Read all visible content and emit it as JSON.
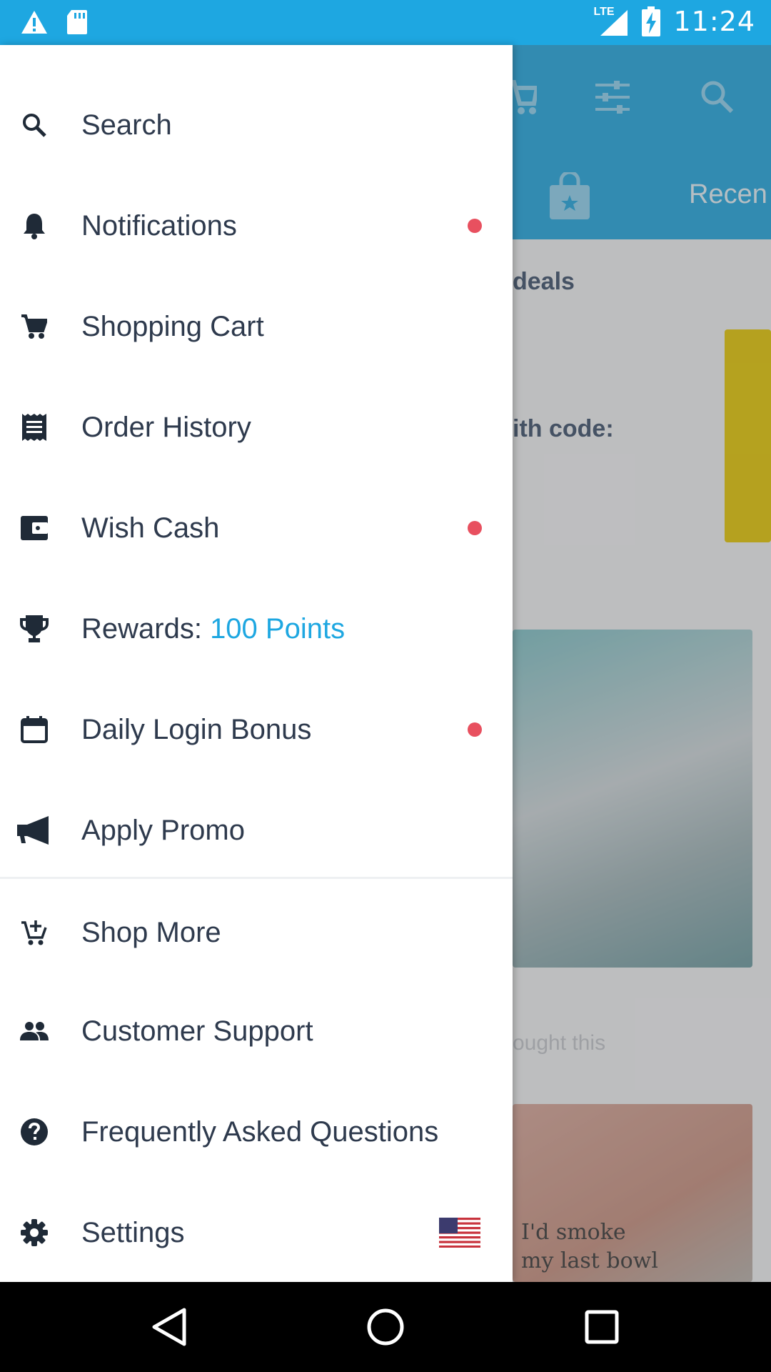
{
  "status_bar": {
    "time": "11:24",
    "network": "LTE",
    "icons": [
      "warning-icon",
      "sd-card-icon",
      "signal-icon",
      "battery-charging-icon"
    ]
  },
  "background": {
    "recent_tab": "Recen",
    "deals_text": "deals",
    "code_text": "ith code:",
    "bought_text": "ought this",
    "product_caption": "I'd smoke my last bowl"
  },
  "drawer": {
    "items": [
      {
        "label": "Search",
        "icon": "search-icon"
      },
      {
        "label": "Notifications",
        "icon": "bell-icon",
        "has_dot": true
      },
      {
        "label": "Shopping Cart",
        "icon": "cart-icon"
      },
      {
        "label": "Order History",
        "icon": "receipt-icon"
      },
      {
        "label": "Wish Cash",
        "icon": "wallet-icon",
        "has_dot": true
      },
      {
        "label": "Rewards: ",
        "accent": "100 Points",
        "icon": "trophy-icon"
      },
      {
        "label": "Daily Login Bonus",
        "icon": "calendar-icon",
        "has_dot": true
      },
      {
        "label": "Apply Promo",
        "icon": "megaphone-icon"
      },
      {
        "label": "Shop More",
        "icon": "add-cart-icon"
      },
      {
        "label": "Customer Support",
        "icon": "people-icon"
      },
      {
        "label": "Frequently Asked Questions",
        "icon": "help-icon"
      },
      {
        "label": "Settings",
        "icon": "gear-icon",
        "flag": "us-flag-icon"
      }
    ]
  },
  "colors": {
    "brand": "#1ea7e1",
    "dot": "#e8505f",
    "text": "#2e3a4d"
  },
  "nav_bar": {
    "buttons": [
      "back-icon",
      "home-icon",
      "recents-icon"
    ]
  }
}
